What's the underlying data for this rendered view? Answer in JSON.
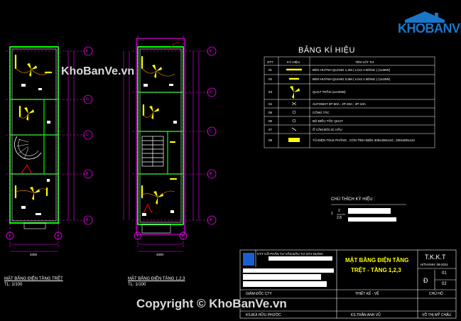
{
  "logo": {
    "text": "KHOBANVE"
  },
  "watermarks": {
    "top": "KhoBanVe.vn",
    "bottom": "Copyright © KhoBanVe.vn"
  },
  "legend": {
    "title": "BẢNG KÍ HIỆU",
    "headers": [
      "STT",
      "KÝ HIỆU",
      "TÊN VẬT TƯ"
    ],
    "rows": [
      {
        "no": "01",
        "name": "ĐÈN HUỲNH QUANG 1,2M ( LOẠI 2 BÓNG ) (1x36W)"
      },
      {
        "no": "02",
        "name": "ĐÈN HUỲNH QUANG 0,6M ( LOẠI 1 BÓNG ) (1x18W)"
      },
      {
        "no": "03",
        "name": "QUẠT TRẦN (1x100W)"
      },
      {
        "no": "04",
        "name": "AUTOMAT 2P-50A ; 2P-20A ; 2P-10A"
      },
      {
        "no": "05",
        "name": "CÔNG TẮC"
      },
      {
        "no": "06",
        "name": "BỘ ĐIỀU TỐC QUẠT"
      },
      {
        "no": "07",
        "name": "Ổ CẮM ĐÔI 2C HẦU"
      },
      {
        "no": "08",
        "name": "TỦ ĐIỆN TOLE PHẲNG , CÓN TÍNH ĐIỆN 300x400x110 ; 200x300x110"
      }
    ]
  },
  "notes": {
    "title": "CHÚ THÍCH KÝ HIỆU :",
    "symbol_top": "2",
    "symbol_left": "1",
    "symbol_bottom": "2.8"
  },
  "plans": {
    "left": {
      "caption": "MẶT BẰNG ĐIỆN TẦNG TRỆT",
      "scale": "TL: 1/100",
      "dim_total": "4000"
    },
    "right": {
      "caption": "MẶT BẰNG ĐIỆN TẦNG 1,2,3",
      "scale": "TL: 1/100",
      "dim_total": "4000"
    },
    "grid_letters": [
      "E",
      "D",
      "C",
      "B",
      "A"
    ],
    "grid_numbers": [
      "1",
      "2"
    ]
  },
  "title_block": {
    "company": "CTY CỔ PHẦN TƯ VẤN ĐẦU TƯ XÂY DỰNG",
    "drawing_title_1": "MẶT BẰNG ĐIỆN TẦNG",
    "drawing_title_2": "TRỆT - TẦNG 1,2,3",
    "code": "T.K.K.T",
    "date": "H/THÀNH: 09-2011",
    "sheet_letter": "Đ",
    "sheet_no": "01",
    "sheet_total": "02",
    "director_label": "GIÁM ĐỐC CTY",
    "design_label": "THIẾT KẾ - VẼ",
    "lead_label": "CHỦ HỘ",
    "director_name": "KS.BÙI HỮU PHƯỚC",
    "design_name": "KS.TRẦN ANH VŨ",
    "lead_name": "VÕ THỊ MỸ CHÂU"
  }
}
